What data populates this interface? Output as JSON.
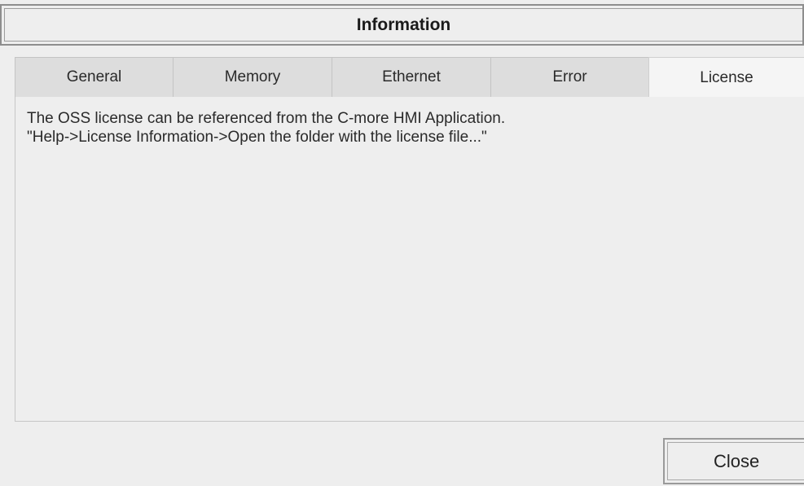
{
  "window": {
    "title": "Information"
  },
  "tabs": [
    {
      "label": "General",
      "active": false
    },
    {
      "label": "Memory",
      "active": false
    },
    {
      "label": "Ethernet",
      "active": false
    },
    {
      "label": "Error",
      "active": false
    },
    {
      "label": "License",
      "active": true
    }
  ],
  "license_panel": {
    "line1": "The OSS license can be referenced from the C-more HMI Application.",
    "line2": "\"Help->License Information->Open the folder with the license file...\""
  },
  "footer": {
    "close_label": "Close"
  },
  "colors": {
    "background": "#eeeeee",
    "tab_inactive": "#dddddd",
    "tab_active": "#f5f5f5",
    "border": "#8e8e8e",
    "text": "#2a2a2a"
  }
}
